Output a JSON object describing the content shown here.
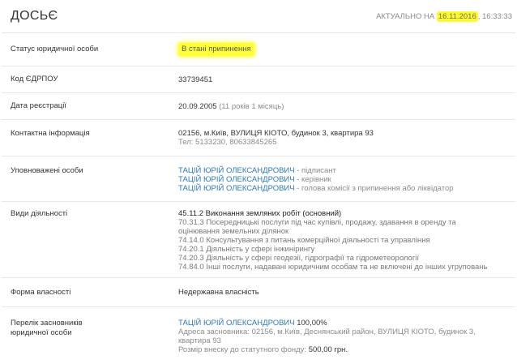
{
  "header": {
    "title": "ДОСЬЄ",
    "actual_prefix": "АКТУАЛЬНО НА",
    "actual_date": "16.11.2016",
    "actual_time": "16:33:33"
  },
  "status": {
    "label": "Статус юридичної особи",
    "value": "В стані припинення"
  },
  "edrpou": {
    "label": "Код ЄДРПОУ",
    "value": "33739451"
  },
  "registration": {
    "label": "Дата реєстрації",
    "date": "20.09.2005",
    "age": "(11 років 1 місяць)"
  },
  "contact": {
    "label": "Контактна інформація",
    "address": "02156, м.Київ, ВУЛИЦЯ КІОТО, будинок 3, квартира 93",
    "phone": "Тел: 5133230, 80633845265"
  },
  "authorized": {
    "label": "Уповноважені особи",
    "persons": [
      {
        "name": "ТАЦІЙ ЮРІЙ ОЛЕКСАНДРОВИЧ",
        "role": " - підписант"
      },
      {
        "name": "ТАЦІЙ ЮРІЙ ОЛЕКСАНДРОВИЧ",
        "role": " - керівник"
      },
      {
        "name": "ТАЦІЙ ЮРІЙ ОЛЕКСАНДРОВИЧ",
        "role": " - голова комісії з припинення або ліквідатор"
      }
    ]
  },
  "activities": {
    "label": "Види діяльності",
    "main": "45.11.2 Виконання земляних робіт (основний)",
    "others": [
      "70.31.3 Посередницькі послуги під час купівлі, продажу, здавання в оренду та оцінювання земельних ділянок",
      "74.14.0 Консультування з питань комерційної діяльності та управління",
      "74.20.1 Діяльність у сфері інжинірингу",
      "74.20.3 Діяльність у сфері геодезії, гідрографії та гідрометеорології",
      "74.84.0 Інші послуги, надавані юридичним особам та не включені до інших угруповань"
    ]
  },
  "ownership": {
    "label": "Форма власності",
    "value": "Недержавна власність"
  },
  "founders": {
    "label": "Перелік засновників юридичної особи",
    "name": "ТАЦІЙ ЮРІЙ ОЛЕКСАНДРОВИЧ",
    "share": " 100,00%",
    "address": "Адреса засновника: 02156, м.Київ, Деснянський район, ВУЛИЦЯ КІОТО, будинок 3, квартира 93",
    "capital_label": "Розмір внеску до статутного фонду: ",
    "capital_value": "500,00 грн."
  }
}
